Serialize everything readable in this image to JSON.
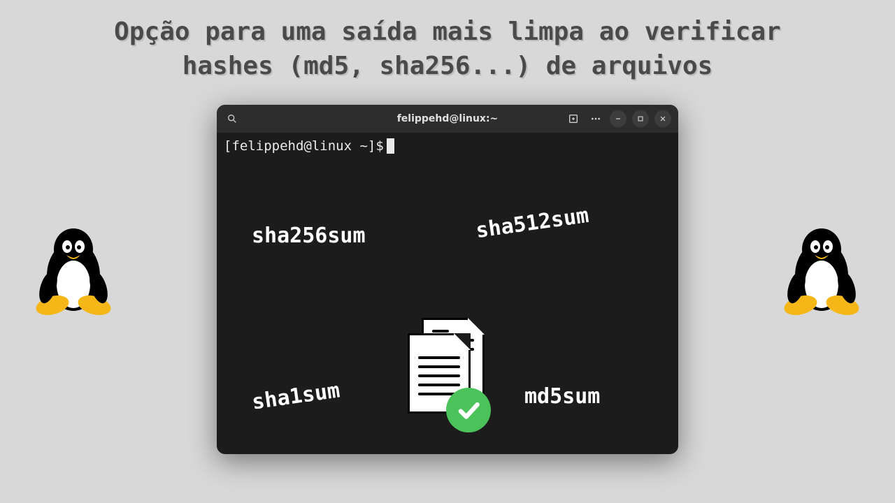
{
  "title_line1": "Opção para uma saída mais limpa ao verificar",
  "title_line2": "hashes (md5, sha256...) de arquivos",
  "terminal": {
    "window_title": "felippehd@linux:~",
    "prompt": "[felippehd@linux ~]$"
  },
  "labels": {
    "sha256sum": "sha256sum",
    "sha512sum": "sha512sum",
    "sha1sum": "sha1sum",
    "md5sum": "md5sum"
  }
}
